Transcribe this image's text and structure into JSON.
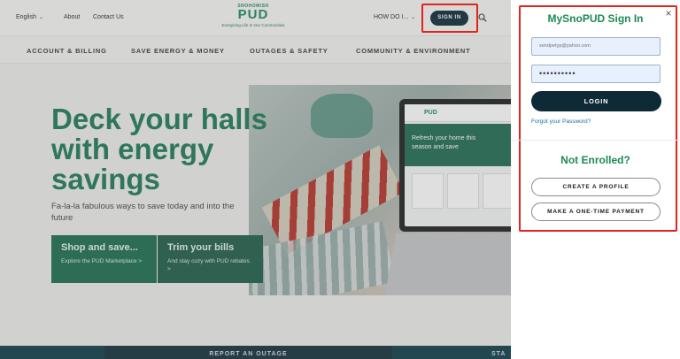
{
  "topbar": {
    "language": "English",
    "about": "About",
    "contact": "Contact Us",
    "logo_top": "SNOHOMISH",
    "logo_main": "PUD",
    "logo_tagline": "Energizing Life In Our Communities",
    "how_do_i": "HOW DO I...",
    "sign_in": "SIGN IN"
  },
  "nav": {
    "items": [
      "ACCOUNT & BILLING",
      "SAVE ENERGY & MONEY",
      "OUTAGES & SAFETY",
      "COMMUNITY & ENVIRONMENT"
    ]
  },
  "hero": {
    "headline": "Deck your halls with energy savings",
    "subline": "Fa-la-la fabulous ways to save today and into the future",
    "cta1_title": "Shop and save...",
    "cta1_sub": "Explore the PUD Marketplace >",
    "cta2_title": "Trim your bills",
    "cta2_sub": "And stay cozy with PUD rebates >",
    "laptop_logo": "PUD",
    "laptop_text": "Refresh your home this season and save"
  },
  "footer": {
    "report_outage": "REPORT AN OUTAGE",
    "start": "STA"
  },
  "signin_panel": {
    "title": "MySnoPUD Sign In",
    "email_value": "sendpetyp@yahoo.com",
    "password_value": "••••••••••",
    "login": "LOGIN",
    "forgot": "Forgot your Password?",
    "not_enrolled": "Not Enrolled?",
    "create_profile": "CREATE A PROFILE",
    "one_time_payment": "MAKE A ONE-TIME PAYMENT",
    "close": "×"
  },
  "colors": {
    "brand_green": "#1e8a55",
    "navy": "#0d2a36",
    "highlight_red": "#e0251b"
  }
}
